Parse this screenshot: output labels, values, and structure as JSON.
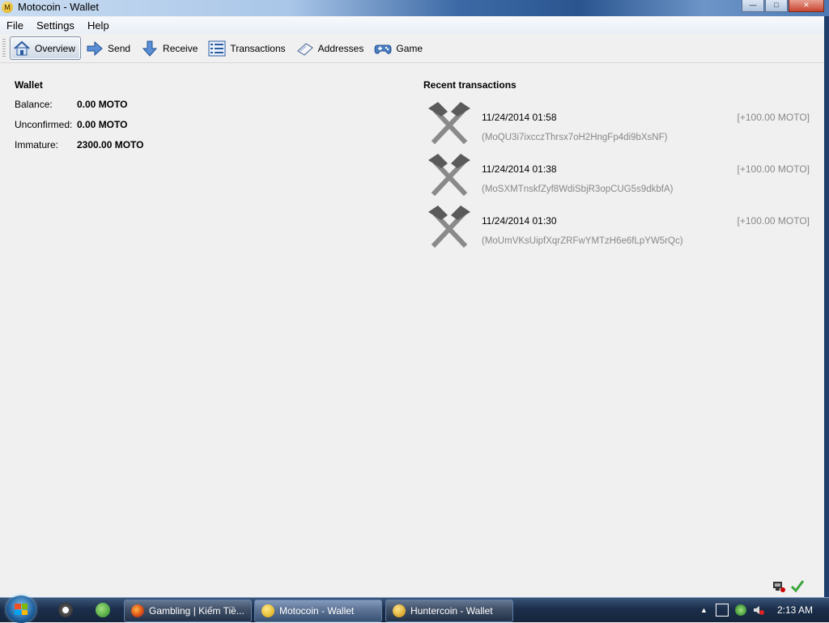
{
  "window": {
    "title": "Motocoin - Wallet",
    "app_icon_letter": "M",
    "controls": {
      "minimize": "—",
      "maximize": "□",
      "close": "✕"
    }
  },
  "menubar": {
    "items": [
      "File",
      "Settings",
      "Help"
    ]
  },
  "toolbar": {
    "items": [
      {
        "label": "Overview",
        "icon": "home-icon",
        "active": true
      },
      {
        "label": "Send",
        "icon": "send-arrow-icon"
      },
      {
        "label": "Receive",
        "icon": "receive-arrow-icon"
      },
      {
        "label": "Transactions",
        "icon": "list-icon"
      },
      {
        "label": "Addresses",
        "icon": "address-book-icon"
      },
      {
        "label": "Game",
        "icon": "gamepad-icon"
      }
    ]
  },
  "wallet": {
    "title": "Wallet",
    "rows": [
      {
        "label": "Balance:",
        "value": "0.00 MOTO"
      },
      {
        "label": "Unconfirmed:",
        "value": "0.00 MOTO"
      },
      {
        "label": "Immature:",
        "value": "2300.00 MOTO"
      }
    ]
  },
  "recent": {
    "title": "Recent transactions",
    "items": [
      {
        "date": "11/24/2014 01:58",
        "amount": "[+100.00 MOTO]",
        "address": "(MoQU3i7ixcczThrsx7oH2HngFp4di9bXsNF)",
        "icon": "mined-hammers-icon"
      },
      {
        "date": "11/24/2014 01:38",
        "amount": "[+100.00 MOTO]",
        "address": "(MoSXMTnskfZyf8WdiSbjR3opCUG5s9dkbfA)",
        "icon": "mined-hammers-icon"
      },
      {
        "date": "11/24/2014 01:30",
        "amount": "[+100.00 MOTO]",
        "address": "(MoUmVKsUipfXqrZRFwYMTzH6e6fLpYW5rQc)",
        "icon": "mined-hammers-icon"
      }
    ]
  },
  "statusbar": {
    "icons": [
      "network-connections-icon",
      "synced-check-icon"
    ]
  },
  "taskbar": {
    "tasks": [
      {
        "label": "Gambling | Kiếm Tiề...",
        "icon": "firefox-icon"
      },
      {
        "label": "Motocoin - Wallet",
        "icon": "motocoin-icon",
        "active": true
      },
      {
        "label": "Huntercoin - Wallet",
        "icon": "huntercoin-icon"
      }
    ],
    "clock": "2:13 AM",
    "tray_arrow": "▲"
  },
  "colors": {
    "muted_text": "#888888",
    "background": "#f0f0f0",
    "taskbar": "#1b2e4a"
  }
}
